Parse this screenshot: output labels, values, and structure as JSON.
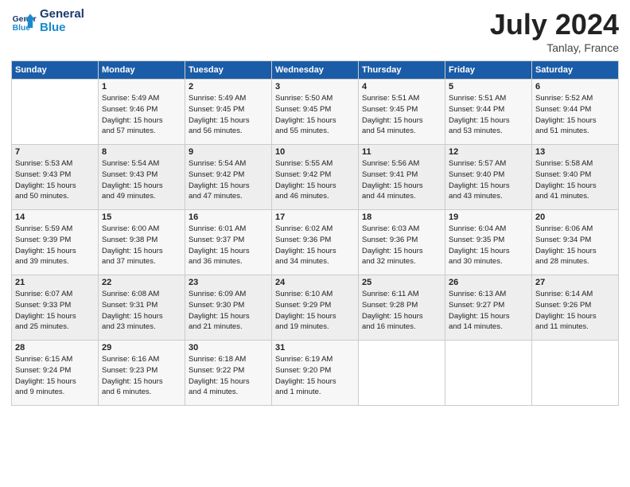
{
  "header": {
    "logo_line1": "General",
    "logo_line2": "Blue",
    "month_title": "July 2024",
    "location": "Tanlay, France"
  },
  "days_of_week": [
    "Sunday",
    "Monday",
    "Tuesday",
    "Wednesday",
    "Thursday",
    "Friday",
    "Saturday"
  ],
  "weeks": [
    [
      {
        "day": "",
        "info": ""
      },
      {
        "day": "1",
        "info": "Sunrise: 5:49 AM\nSunset: 9:46 PM\nDaylight: 15 hours\nand 57 minutes."
      },
      {
        "day": "2",
        "info": "Sunrise: 5:49 AM\nSunset: 9:45 PM\nDaylight: 15 hours\nand 56 minutes."
      },
      {
        "day": "3",
        "info": "Sunrise: 5:50 AM\nSunset: 9:45 PM\nDaylight: 15 hours\nand 55 minutes."
      },
      {
        "day": "4",
        "info": "Sunrise: 5:51 AM\nSunset: 9:45 PM\nDaylight: 15 hours\nand 54 minutes."
      },
      {
        "day": "5",
        "info": "Sunrise: 5:51 AM\nSunset: 9:44 PM\nDaylight: 15 hours\nand 53 minutes."
      },
      {
        "day": "6",
        "info": "Sunrise: 5:52 AM\nSunset: 9:44 PM\nDaylight: 15 hours\nand 51 minutes."
      }
    ],
    [
      {
        "day": "7",
        "info": "Sunrise: 5:53 AM\nSunset: 9:43 PM\nDaylight: 15 hours\nand 50 minutes."
      },
      {
        "day": "8",
        "info": "Sunrise: 5:54 AM\nSunset: 9:43 PM\nDaylight: 15 hours\nand 49 minutes."
      },
      {
        "day": "9",
        "info": "Sunrise: 5:54 AM\nSunset: 9:42 PM\nDaylight: 15 hours\nand 47 minutes."
      },
      {
        "day": "10",
        "info": "Sunrise: 5:55 AM\nSunset: 9:42 PM\nDaylight: 15 hours\nand 46 minutes."
      },
      {
        "day": "11",
        "info": "Sunrise: 5:56 AM\nSunset: 9:41 PM\nDaylight: 15 hours\nand 44 minutes."
      },
      {
        "day": "12",
        "info": "Sunrise: 5:57 AM\nSunset: 9:40 PM\nDaylight: 15 hours\nand 43 minutes."
      },
      {
        "day": "13",
        "info": "Sunrise: 5:58 AM\nSunset: 9:40 PM\nDaylight: 15 hours\nand 41 minutes."
      }
    ],
    [
      {
        "day": "14",
        "info": "Sunrise: 5:59 AM\nSunset: 9:39 PM\nDaylight: 15 hours\nand 39 minutes."
      },
      {
        "day": "15",
        "info": "Sunrise: 6:00 AM\nSunset: 9:38 PM\nDaylight: 15 hours\nand 37 minutes."
      },
      {
        "day": "16",
        "info": "Sunrise: 6:01 AM\nSunset: 9:37 PM\nDaylight: 15 hours\nand 36 minutes."
      },
      {
        "day": "17",
        "info": "Sunrise: 6:02 AM\nSunset: 9:36 PM\nDaylight: 15 hours\nand 34 minutes."
      },
      {
        "day": "18",
        "info": "Sunrise: 6:03 AM\nSunset: 9:36 PM\nDaylight: 15 hours\nand 32 minutes."
      },
      {
        "day": "19",
        "info": "Sunrise: 6:04 AM\nSunset: 9:35 PM\nDaylight: 15 hours\nand 30 minutes."
      },
      {
        "day": "20",
        "info": "Sunrise: 6:06 AM\nSunset: 9:34 PM\nDaylight: 15 hours\nand 28 minutes."
      }
    ],
    [
      {
        "day": "21",
        "info": "Sunrise: 6:07 AM\nSunset: 9:33 PM\nDaylight: 15 hours\nand 25 minutes."
      },
      {
        "day": "22",
        "info": "Sunrise: 6:08 AM\nSunset: 9:31 PM\nDaylight: 15 hours\nand 23 minutes."
      },
      {
        "day": "23",
        "info": "Sunrise: 6:09 AM\nSunset: 9:30 PM\nDaylight: 15 hours\nand 21 minutes."
      },
      {
        "day": "24",
        "info": "Sunrise: 6:10 AM\nSunset: 9:29 PM\nDaylight: 15 hours\nand 19 minutes."
      },
      {
        "day": "25",
        "info": "Sunrise: 6:11 AM\nSunset: 9:28 PM\nDaylight: 15 hours\nand 16 minutes."
      },
      {
        "day": "26",
        "info": "Sunrise: 6:13 AM\nSunset: 9:27 PM\nDaylight: 15 hours\nand 14 minutes."
      },
      {
        "day": "27",
        "info": "Sunrise: 6:14 AM\nSunset: 9:26 PM\nDaylight: 15 hours\nand 11 minutes."
      }
    ],
    [
      {
        "day": "28",
        "info": "Sunrise: 6:15 AM\nSunset: 9:24 PM\nDaylight: 15 hours\nand 9 minutes."
      },
      {
        "day": "29",
        "info": "Sunrise: 6:16 AM\nSunset: 9:23 PM\nDaylight: 15 hours\nand 6 minutes."
      },
      {
        "day": "30",
        "info": "Sunrise: 6:18 AM\nSunset: 9:22 PM\nDaylight: 15 hours\nand 4 minutes."
      },
      {
        "day": "31",
        "info": "Sunrise: 6:19 AM\nSunset: 9:20 PM\nDaylight: 15 hours\nand 1 minute."
      },
      {
        "day": "",
        "info": ""
      },
      {
        "day": "",
        "info": ""
      },
      {
        "day": "",
        "info": ""
      }
    ]
  ]
}
